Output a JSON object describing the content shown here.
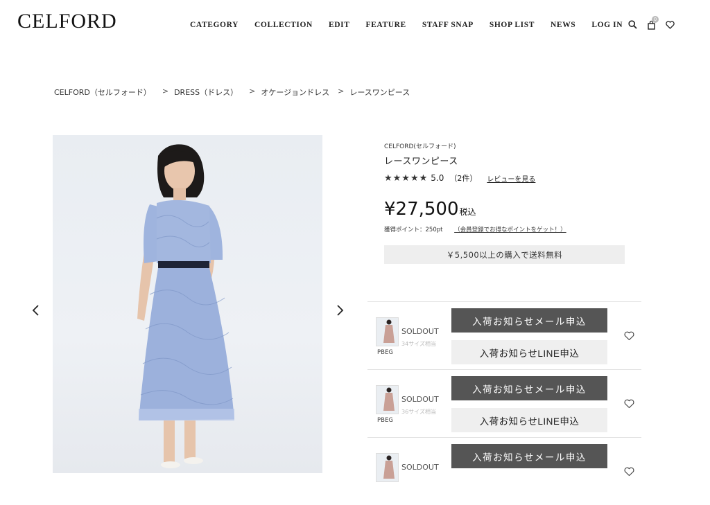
{
  "header": {
    "logo": "CELFORD",
    "nav": [
      "CATEGORY",
      "COLLECTION",
      "EDIT",
      "FEATURE",
      "STAFF SNAP",
      "SHOP LIST",
      "NEWS",
      "LOG IN"
    ],
    "cart_count": "0",
    "icons": [
      "search-icon",
      "cart-icon",
      "heart-icon"
    ]
  },
  "breadcrumb": {
    "items": [
      "CELFORD（セルフォード）",
      "DRESS（ドレス）",
      "オケージョンドレス",
      "レースワンピース"
    ],
    "separator": ">"
  },
  "product": {
    "brand": "CELFORD(セルフォード)",
    "title": "レースワンピース",
    "stars": "★★★★★",
    "rating": "5.0",
    "review_count": "（2件）",
    "review_link": "レビューを見る",
    "price": "¥27,500",
    "tax_label": "税込",
    "points": "獲得ポイント：250pt",
    "points_link": "（会員登録でお得なポイントをゲット！）",
    "shipping_note": "￥5,500以上の購入で送料無料"
  },
  "skus": [
    {
      "code": "PBEG",
      "status": "SOLDOUT",
      "size": "34サイズ相当",
      "mail_btn": "入荷お知らせメール申込",
      "line_btn": "入荷お知らせLINE申込"
    },
    {
      "code": "PBEG",
      "status": "SOLDOUT",
      "size": "36サイズ相当",
      "mail_btn": "入荷お知らせメール申込",
      "line_btn": "入荷お知らせLINE申込"
    },
    {
      "code": "",
      "status": "SOLDOUT",
      "size": "",
      "mail_btn": "入荷お知らせメール申込",
      "line_btn": ""
    }
  ],
  "colors": {
    "dress": "#9fb4de",
    "button_dark": "#555555",
    "button_light": "#efefef"
  }
}
